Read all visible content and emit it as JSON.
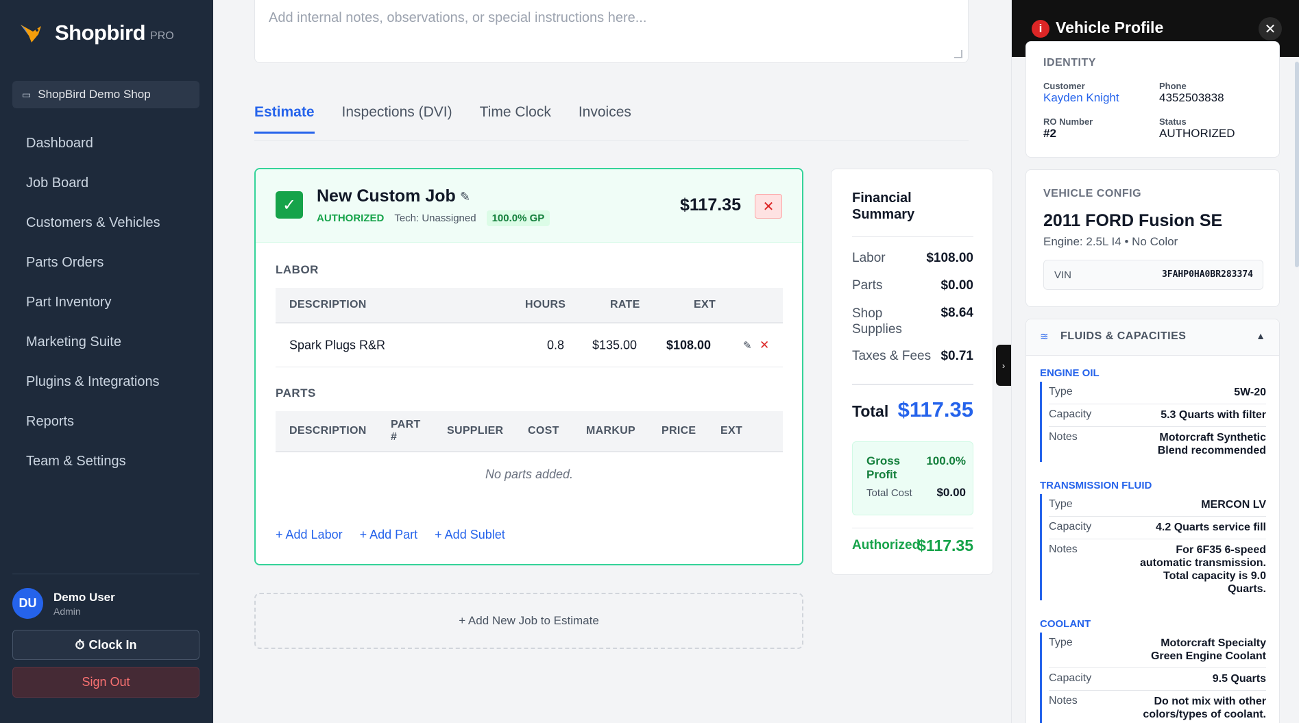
{
  "sidebar": {
    "brand": "Shopbird",
    "brand_suffix": "PRO",
    "shop_name": "ShopBird Demo Shop",
    "nav": [
      {
        "label": "Dashboard"
      },
      {
        "label": "Job Board"
      },
      {
        "label": "Customers & Vehicles"
      },
      {
        "label": "Parts Orders"
      },
      {
        "label": "Part Inventory"
      },
      {
        "label": "Marketing Suite"
      },
      {
        "label": "Plugins & Integrations"
      },
      {
        "label": "Reports"
      },
      {
        "label": "Team & Settings"
      }
    ],
    "user": {
      "initials": "DU",
      "name": "Demo User",
      "role": "Admin"
    },
    "clock_in": "Clock In",
    "sign_out": "Sign Out"
  },
  "notes": {
    "placeholder": "Add internal notes, observations, or special instructions here..."
  },
  "tabs": [
    {
      "label": "Estimate",
      "active": true
    },
    {
      "label": "Inspections (DVI)"
    },
    {
      "label": "Time Clock"
    },
    {
      "label": "Invoices"
    }
  ],
  "job": {
    "title": "New Custom Job",
    "status": "AUTHORIZED",
    "tech": "Tech: Unassigned",
    "gp": "100.0% GP",
    "price": "$117.35",
    "labor_title": "LABOR",
    "labor_headers": {
      "description": "DESCRIPTION",
      "hours": "HOURS",
      "rate": "RATE",
      "ext": "EXT"
    },
    "labor_rows": [
      {
        "description": "Spark Plugs R&R",
        "hours": "0.8",
        "rate": "$135.00",
        "ext": "$108.00"
      }
    ],
    "parts_title": "PARTS",
    "parts_headers": {
      "description": "DESCRIPTION",
      "part_no": "PART #",
      "supplier": "SUPPLIER",
      "cost": "COST",
      "markup": "MARKUP",
      "price": "PRICE",
      "ext": "EXT"
    },
    "parts_empty": "No parts added.",
    "add_labor": "+ Add Labor",
    "add_part": "+ Add Part",
    "add_sublet": "+ Add Sublet"
  },
  "add_new_job": "+ Add New Job to Estimate",
  "financial": {
    "title": "Financial Summary",
    "rows": [
      {
        "label": "Labor",
        "value": "$108.00"
      },
      {
        "label": "Parts",
        "value": "$0.00"
      },
      {
        "label": "Shop Supplies",
        "value": "$8.64"
      },
      {
        "label": "Taxes & Fees",
        "value": "$0.71"
      }
    ],
    "total_label": "Total",
    "total_value": "$117.35",
    "gross_profit_label": "Gross Profit",
    "gross_profit_value": "100.0%",
    "total_cost_label": "Total Cost",
    "total_cost_value": "$0.00",
    "authorized_label": "Authorized",
    "authorized_value": "$117.35"
  },
  "vehicle_panel": {
    "title": "Vehicle Profile",
    "identity_title": "IDENTITY",
    "customer_label": "Customer",
    "customer_value": "Kayden Knight",
    "phone_label": "Phone",
    "phone_value": "4352503838",
    "ro_label": "RO Number",
    "ro_value": "#2",
    "status_label": "Status",
    "status_value": "AUTHORIZED",
    "config_title": "VEHICLE CONFIG",
    "vehicle_name": "2011 FORD Fusion SE",
    "engine": "Engine: 2.5L I4 • No Color",
    "vin_label": "VIN",
    "vin_value": "3FAHP0HA0BR283374",
    "fluids_title": "FLUIDS & CAPACITIES",
    "fluids": [
      {
        "name": "ENGINE OIL",
        "rows": [
          {
            "k": "Type",
            "v": "5W-20"
          },
          {
            "k": "Capacity",
            "v": "5.3 Quarts with filter"
          },
          {
            "k": "Notes",
            "v": "Motorcraft Synthetic Blend recommended"
          }
        ]
      },
      {
        "name": "TRANSMISSION FLUID",
        "rows": [
          {
            "k": "Type",
            "v": "MERCON LV"
          },
          {
            "k": "Capacity",
            "v": "4.2 Quarts service fill"
          },
          {
            "k": "Notes",
            "v": "For 6F35 6-speed automatic transmission. Total capacity is 9.0 Quarts."
          }
        ]
      },
      {
        "name": "COOLANT",
        "rows": [
          {
            "k": "Type",
            "v": "Motorcraft Specialty Green Engine Coolant"
          },
          {
            "k": "Capacity",
            "v": "9.5 Quarts"
          },
          {
            "k": "Notes",
            "v": "Do not mix with other colors/types of coolant."
          }
        ]
      }
    ]
  }
}
